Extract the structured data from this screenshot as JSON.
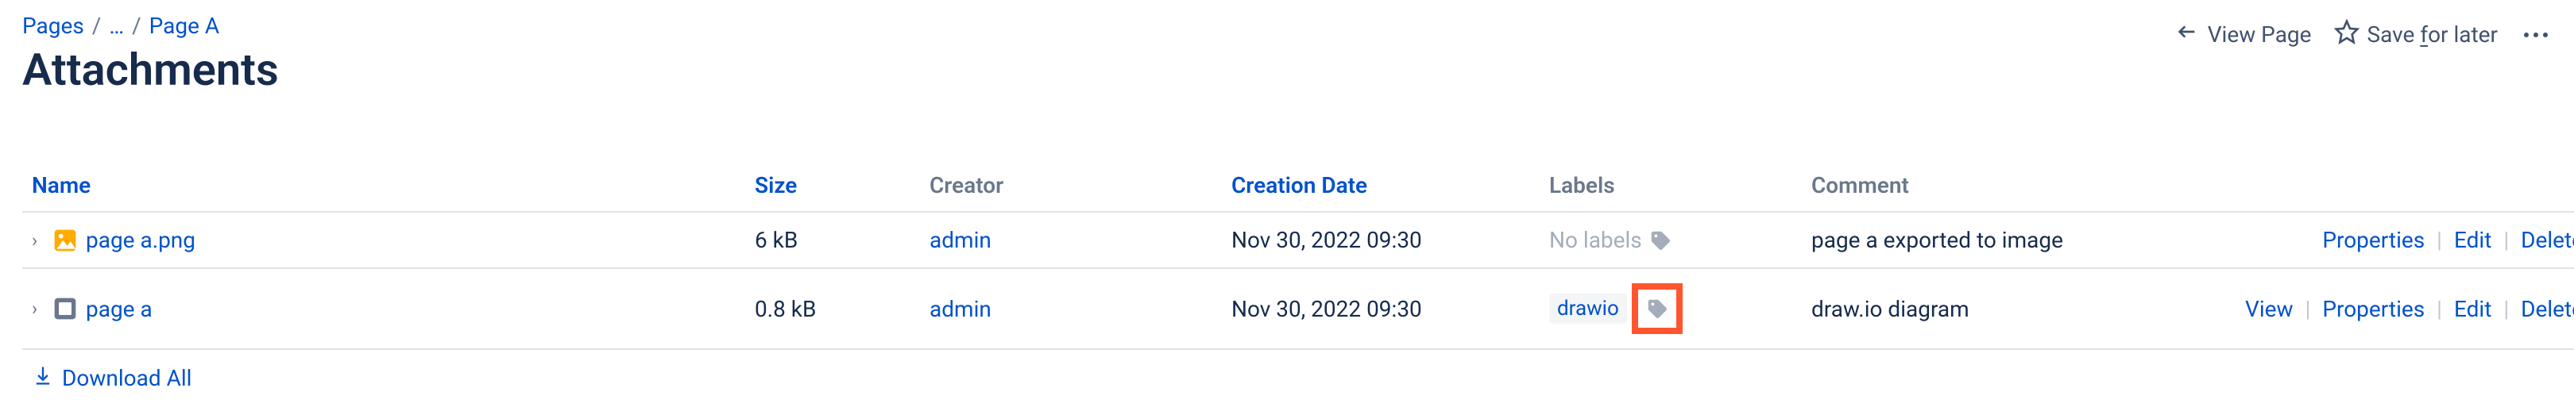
{
  "breadcrumb": {
    "root": "Pages",
    "ellipsis": "…",
    "current": "Page A"
  },
  "page_title": "Attachments",
  "toolbar": {
    "view_page": "View Page",
    "save_for_later_pre": "Save ",
    "save_for_later_f": "f",
    "save_for_later_post": "or later"
  },
  "columns": {
    "name": "Name",
    "size": "Size",
    "creator": "Creator",
    "creation_date": "Creation Date",
    "labels": "Labels",
    "comment": "Comment"
  },
  "rows": [
    {
      "name": "page a.png",
      "icon": "image",
      "size": "6 kB",
      "creator": "admin",
      "date": "Nov 30, 2022 09:30",
      "labels_mode": "none",
      "no_labels_text": "No labels",
      "comment": "page a exported to image",
      "actions": [
        "Properties",
        "Edit",
        "Delete"
      ]
    },
    {
      "name": "page a",
      "icon": "app",
      "size": "0.8 kB",
      "creator": "admin",
      "date": "Nov 30, 2022 09:30",
      "labels_mode": "chip-highlight",
      "chip": "drawio",
      "comment": "draw.io diagram",
      "actions": [
        "View",
        "Properties",
        "Edit",
        "Delete"
      ]
    }
  ],
  "download_all": "Download All"
}
